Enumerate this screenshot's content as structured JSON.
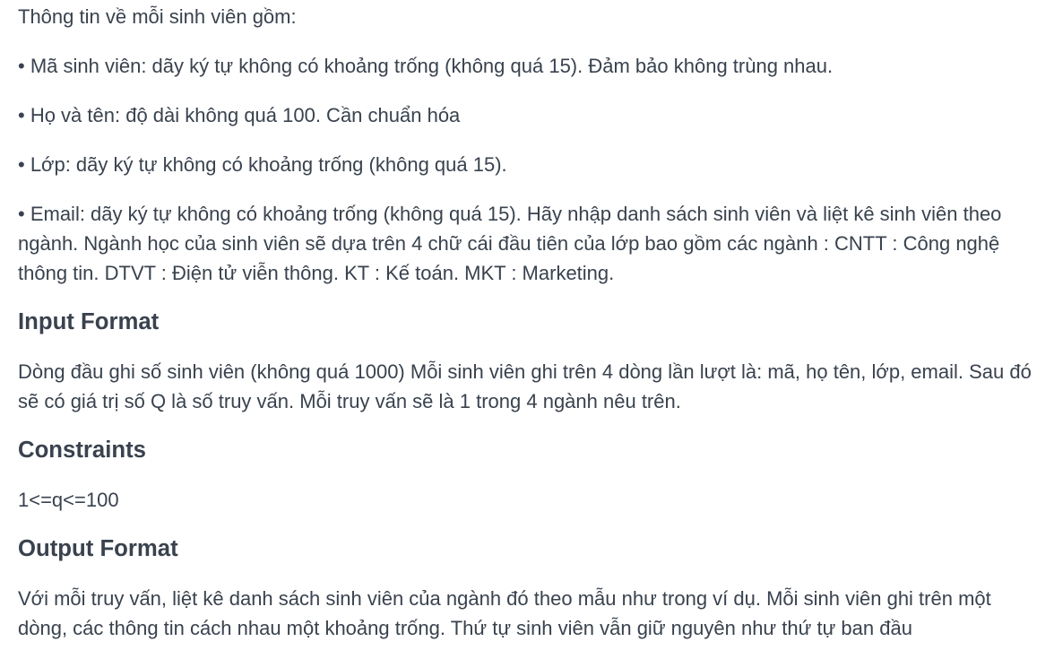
{
  "content": {
    "intro": "Thông tin về mỗi sinh viên gồm:",
    "bullets": [
      "• Mã sinh viên: dãy ký tự không có khoảng trống (không quá 15). Đảm bảo không trùng nhau.",
      "• Họ và tên: độ dài không quá 100. Cần chuẩn hóa",
      "• Lớp: dãy ký tự không có khoảng trống (không quá 15).",
      "• Email: dãy ký tự không có khoảng trống (không quá 15). Hãy nhập danh sách sinh viên và liệt kê sinh viên theo ngành. Ngành học của sinh viên sẽ dựa trên 4 chữ cái đầu tiên của lớp bao gồm các ngành : CNTT : Công nghệ thông tin. DTVT : Điện tử viễn thông. KT : Kế toán. MKT : Marketing."
    ],
    "input_format": {
      "heading": "Input Format",
      "text": "Dòng đầu ghi số sinh viên (không quá 1000) Mỗi sinh viên ghi trên 4 dòng lần lượt là: mã, họ tên, lớp, email. Sau đó sẽ có giá trị số Q là số truy vấn. Mỗi truy vấn sẽ là 1 trong 4 ngành nêu trên."
    },
    "constraints": {
      "heading": "Constraints",
      "text": "1<=q<=100"
    },
    "output_format": {
      "heading": "Output Format",
      "text": "Với mỗi truy vấn, liệt kê danh sách sinh viên của ngành đó theo mẫu như trong ví dụ. Mỗi sinh viên ghi trên một dòng, các thông tin cách nhau một khoảng trống. Thứ tự sinh viên vẫn giữ nguyên như thứ tự ban đầu"
    }
  },
  "colors": {
    "text": "#39424e",
    "background": "#ffffff"
  }
}
